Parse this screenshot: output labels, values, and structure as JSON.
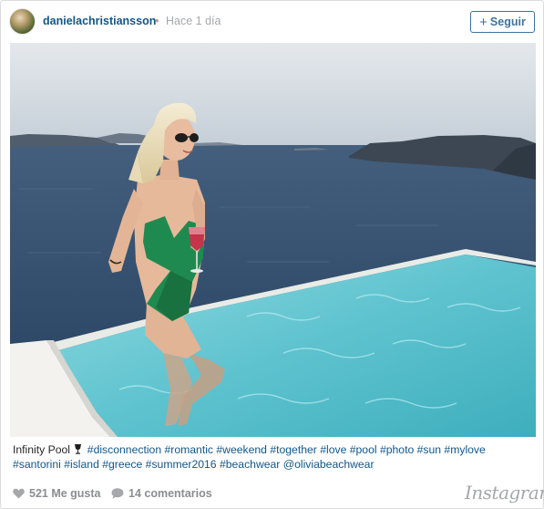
{
  "post": {
    "username": "danielachristiansson",
    "separator": "•",
    "time_ago": "Hace 1 día",
    "follow_label": "Seguir",
    "follow_symbol": "+"
  },
  "photo": {
    "alt": "Woman in green swimsuit holding a drink at an infinity pool overlooking the sea",
    "colors": {
      "sky": "#cfd6dd",
      "sea": "#3a5777",
      "pool": "#6ecad5",
      "deck": "#f2f1ec",
      "swimsuit": "#1f8a50"
    }
  },
  "caption": {
    "title": "Infinity Pool",
    "emoji_icon": "cocktail-glass-icon",
    "tags_line1": "#disconnection #romantic #weekend #together #love #pool #photo #sun #mylove",
    "tags_line2": "#santorini #island #greece #summer2016 #beachwear @oliviabeachwear"
  },
  "stats": {
    "likes": "521 Me gusta",
    "comments": "14 comentarios"
  },
  "brand": "Instagram"
}
